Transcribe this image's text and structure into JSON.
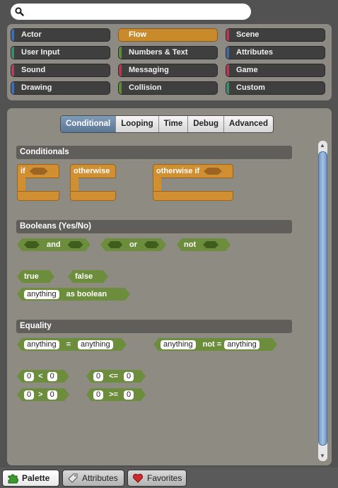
{
  "search": {
    "placeholder": "",
    "value": ""
  },
  "categories": [
    {
      "label": "Actor",
      "color": "#3d6fb4"
    },
    {
      "label": "Flow",
      "color": "#c98a2c"
    },
    {
      "label": "Scene",
      "color": "#b03a54"
    },
    {
      "label": "User Input",
      "color": "#3f8a6c"
    },
    {
      "label": "Numbers & Text",
      "color": "#5e8a3a"
    },
    {
      "label": "Attributes",
      "color": "#3f6a9a"
    },
    {
      "label": "Sound",
      "color": "#b04060"
    },
    {
      "label": "Messaging",
      "color": "#b03a54"
    },
    {
      "label": "Game",
      "color": "#b03a54"
    },
    {
      "label": "Drawing",
      "color": "#3d6fb4"
    },
    {
      "label": "Collision",
      "color": "#5e8a3a"
    },
    {
      "label": "Custom",
      "color": "#3f8a6c"
    }
  ],
  "active_category": "Flow",
  "tabs": [
    "Conditional",
    "Looping",
    "Time",
    "Debug",
    "Advanced"
  ],
  "active_tab": "Conditional",
  "sections": {
    "conditionals": "Conditionals",
    "booleans": "Booleans (Yes/No)",
    "equality": "Equality"
  },
  "blocks": {
    "if": "if",
    "otherwise": "otherwise",
    "otherwise_if": "otherwise if",
    "and": "and",
    "or": "or",
    "not": "not",
    "true": "true",
    "false": "false",
    "anything": "anything",
    "as_boolean": "as boolean",
    "eq": "=",
    "not_eq": "not =",
    "zero": "0",
    "lt": "<",
    "lte": "<=",
    "gt": ">",
    "gte": ">="
  },
  "bottom_tabs": [
    "Palette",
    "Attributes",
    "Favorites"
  ],
  "colors": {
    "flow_orange": "#d08f30",
    "logic_green": "#6c8e3c",
    "accent_blue": "#5b7796"
  }
}
